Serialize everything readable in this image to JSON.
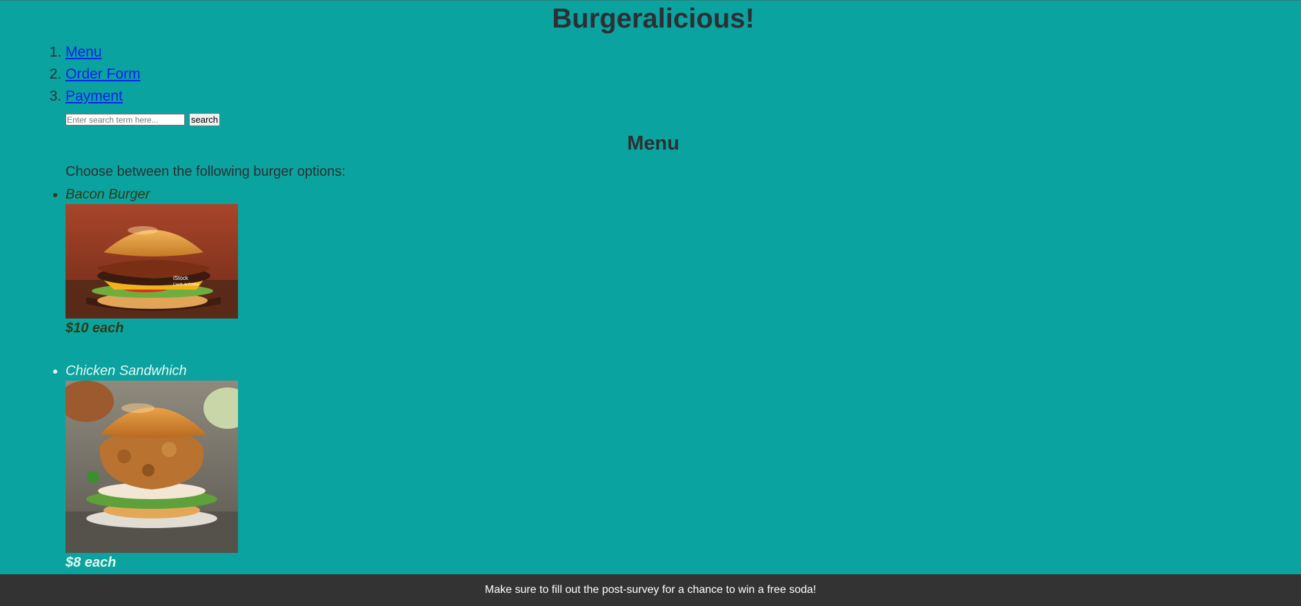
{
  "site_title": "Burgeralicious!",
  "nav": {
    "items": [
      {
        "label": "Menu"
      },
      {
        "label": "Order Form"
      },
      {
        "label": "Payment"
      }
    ]
  },
  "search": {
    "placeholder": "Enter search term here...",
    "button_label": "search"
  },
  "menu": {
    "heading": "Menu",
    "intro": "Choose between the following burger options:",
    "items": [
      {
        "name": "Bacon Burger",
        "price": "$10 each",
        "photo_caption": "iStock",
        "photo_credit": "Credit: ArtSoldier"
      },
      {
        "name": "Chicken Sandwhich",
        "price": "$8 each"
      }
    ]
  },
  "footer": {
    "text": "Make sure to fill out the post-survey for a chance to win a free soda!"
  },
  "colors": {
    "background": "#0aa39f",
    "heading_text": "#2c2f33",
    "link": "#0a1ef0",
    "footer_bg": "#333333"
  }
}
